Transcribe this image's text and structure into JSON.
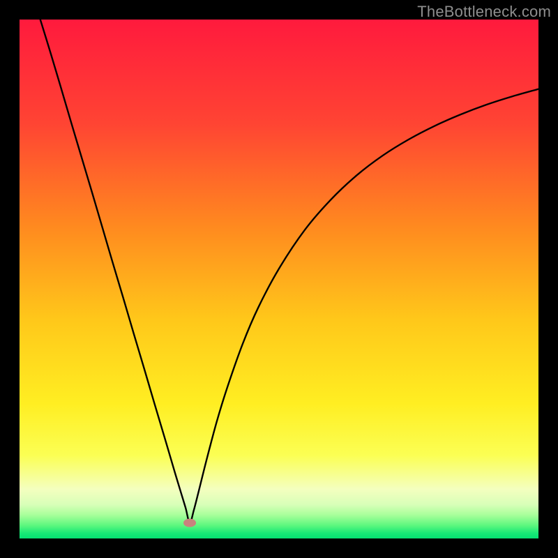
{
  "watermark": "TheBottleneck.com",
  "chart_data": {
    "type": "line",
    "title": "",
    "xlabel": "",
    "ylabel": "",
    "xlim": [
      0,
      100
    ],
    "ylim": [
      0,
      100
    ],
    "grid": false,
    "legend": false,
    "gradient_stops": [
      {
        "offset": 0.0,
        "color": "#ff1a3d"
      },
      {
        "offset": 0.2,
        "color": "#ff4433"
      },
      {
        "offset": 0.4,
        "color": "#ff8a1f"
      },
      {
        "offset": 0.58,
        "color": "#ffc81a"
      },
      {
        "offset": 0.74,
        "color": "#ffee22"
      },
      {
        "offset": 0.84,
        "color": "#fbff54"
      },
      {
        "offset": 0.905,
        "color": "#f4ffbf"
      },
      {
        "offset": 0.935,
        "color": "#d8ffb8"
      },
      {
        "offset": 0.955,
        "color": "#a7ff9a"
      },
      {
        "offset": 0.975,
        "color": "#5cf77e"
      },
      {
        "offset": 0.99,
        "color": "#17e876"
      },
      {
        "offset": 1.0,
        "color": "#05e172"
      }
    ],
    "minimum_marker": {
      "x": 32.8,
      "y": 3.0,
      "color": "#c9817e"
    },
    "series": [
      {
        "name": "curve",
        "color": "#000000",
        "x": [
          4.0,
          6.0,
          8.0,
          10.0,
          12.0,
          14.0,
          16.0,
          18.0,
          20.0,
          22.0,
          24.0,
          26.0,
          28.0,
          30.0,
          31.0,
          32.0,
          32.8,
          33.6,
          34.5,
          36.0,
          38.0,
          40.0,
          43.0,
          46.0,
          50.0,
          55.0,
          60.0,
          65.0,
          70.0,
          75.0,
          80.0,
          85.0,
          90.0,
          95.0,
          100.0
        ],
        "y": [
          100.0,
          93.5,
          86.8,
          80.0,
          73.3,
          66.6,
          59.8,
          53.0,
          46.3,
          39.5,
          32.8,
          26.0,
          19.3,
          12.5,
          9.2,
          5.9,
          3.0,
          5.5,
          9.0,
          15.0,
          22.5,
          29.0,
          37.5,
          44.5,
          52.0,
          59.5,
          65.3,
          70.0,
          73.8,
          76.9,
          79.5,
          81.7,
          83.6,
          85.2,
          86.6
        ]
      }
    ]
  }
}
